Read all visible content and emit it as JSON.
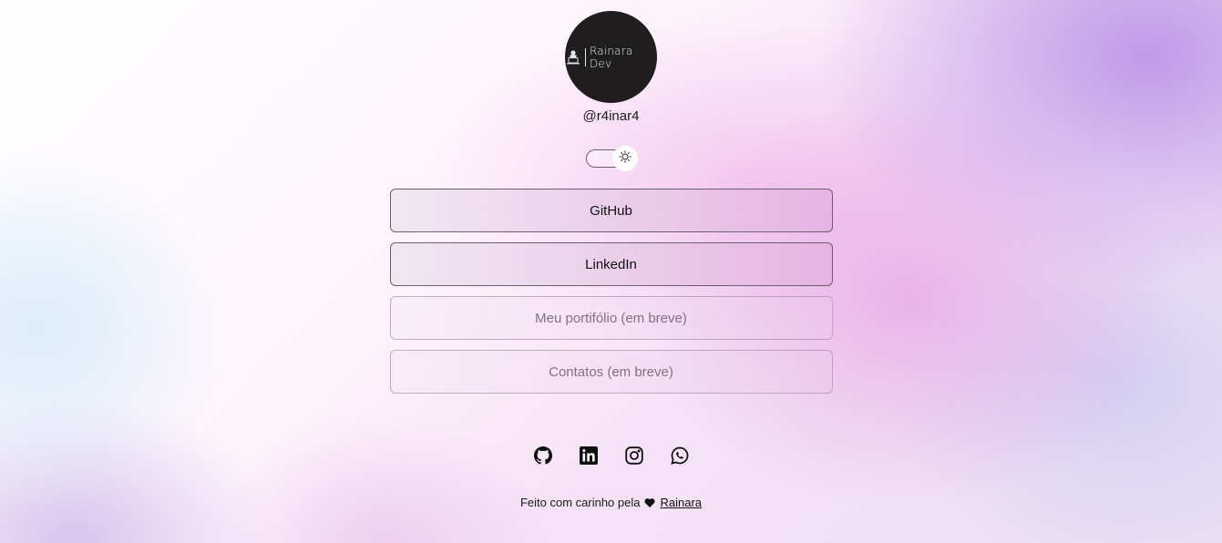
{
  "profile": {
    "avatar_logo_text": "Rainara Dev",
    "handle": "@r4inar4"
  },
  "theme_toggle": {
    "icon": "sun-icon",
    "state": "light"
  },
  "links": [
    {
      "label": "GitHub",
      "state": "active"
    },
    {
      "label": "LinkedIn",
      "state": "active"
    },
    {
      "label": "Meu portifólio (em breve)",
      "state": "disabled"
    },
    {
      "label": "Contatos (em breve)",
      "state": "disabled"
    }
  ],
  "socials": [
    {
      "icon": "github-icon"
    },
    {
      "icon": "linkedin-icon"
    },
    {
      "icon": "instagram-icon"
    },
    {
      "icon": "whatsapp-icon"
    }
  ],
  "footer": {
    "text": "Feito com carinho pela",
    "heart_icon": "heart-icon",
    "author_link": "Rainara"
  }
}
